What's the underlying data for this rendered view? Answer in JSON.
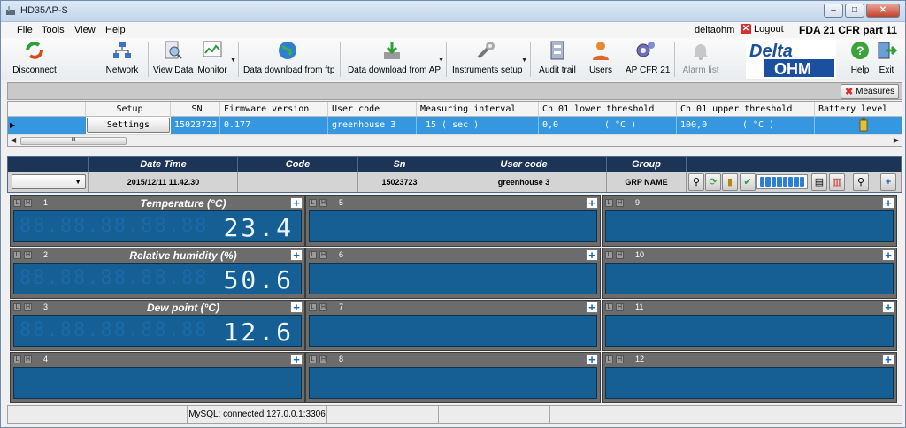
{
  "window": {
    "title": "HD35AP-S"
  },
  "menu": {
    "items": [
      "File",
      "Tools",
      "View",
      "Help"
    ],
    "user": "deltaohm",
    "logout": "Logout",
    "fda": "FDA 21 CFR part 11"
  },
  "toolbar": {
    "disconnect": "Disconnect",
    "network": "Network",
    "view_data": "View Data",
    "monitor": "Monitor",
    "download_ftp": "Data download from ftp",
    "download_ap": "Data download from AP",
    "instruments_setup": "Instruments setup",
    "audit_trail": "Audit trail",
    "users": "Users",
    "ap_cfr21": "AP CFR 21",
    "alarm_list": "Alarm list",
    "help": "Help",
    "exit": "Exit",
    "logo_top": "Delta",
    "logo_bottom": "OHM"
  },
  "measures_button": "Measures",
  "device_grid": {
    "headers": [
      "Setup",
      "SN",
      "Firmware version",
      "User code",
      "Measuring interval",
      "Ch 01 lower threshold",
      "Ch 01 upper threshold",
      "Battery level"
    ],
    "row": {
      "setup": "Settings",
      "sn": "15023723",
      "firmware": "0.177",
      "user_code": "greenhouse 3",
      "interval": "15 ( sec )",
      "lower": "0,0",
      "lower_unit": "( °C )",
      "upper": "100,0",
      "upper_unit": "( °C )"
    },
    "scroll_label": "III"
  },
  "status_panel": {
    "headers": [
      "Date Time",
      "Code",
      "Sn",
      "User code",
      "Group"
    ],
    "values": {
      "datetime": "2015/12/11 11.42.30",
      "code": "",
      "sn": "15023723",
      "user_code": "greenhouse 3",
      "group": "GRP NAME"
    }
  },
  "channels": [
    {
      "num": "1",
      "name": "Temperature (°C)",
      "value": "23.4"
    },
    {
      "num": "5",
      "name": "",
      "value": ""
    },
    {
      "num": "9",
      "name": "",
      "value": ""
    },
    {
      "num": "2",
      "name": "Relative humidity (%)",
      "value": "50.6"
    },
    {
      "num": "6",
      "name": "",
      "value": ""
    },
    {
      "num": "10",
      "name": "",
      "value": ""
    },
    {
      "num": "3",
      "name": "Dew point (°C)",
      "value": "12.6"
    },
    {
      "num": "7",
      "name": "",
      "value": ""
    },
    {
      "num": "11",
      "name": "",
      "value": ""
    },
    {
      "num": "4",
      "name": "",
      "value": ""
    },
    {
      "num": "8",
      "name": "",
      "value": ""
    },
    {
      "num": "12",
      "name": "",
      "value": ""
    }
  ],
  "channel_labels": {
    "low": "L",
    "high": "H"
  },
  "statusbar": {
    "mysql": "MySQL: connected 127.0.0.1:3306"
  },
  "colors": {
    "display_bg": "#155f95",
    "header_bg": "#1c3556",
    "selected_row": "#3497e0",
    "channel_frame": "#6c6c6c"
  }
}
